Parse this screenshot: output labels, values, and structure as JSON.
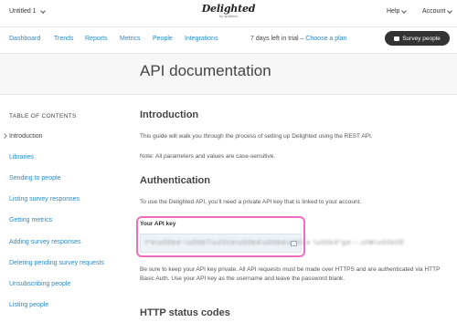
{
  "topbar": {
    "workspace": "Untitled 1",
    "logo_main": "Delighted",
    "logo_sub": "by qualtrics",
    "help": "Help",
    "account": "Account"
  },
  "nav": {
    "items": [
      "Dashboard",
      "Trends",
      "Reports",
      "Metrics",
      "People",
      "Integrations"
    ],
    "trial_text": "7 days left in trial –",
    "trial_link": "Choose a plan",
    "survey_button": "Survey people"
  },
  "page": {
    "title": "API documentation"
  },
  "toc": {
    "title": "TABLE OF CONTENTS",
    "items": [
      "Introduction",
      "Libraries",
      "Sending to people",
      "Listing survey responses",
      "Getting metrics",
      "Adding survey responses",
      "Deleting pending survey requests",
      "Unsubscribing people",
      "Listing people"
    ]
  },
  "content": {
    "intro_heading": "Introduction",
    "intro_p1": "This guide will walk you through the process of setting up Delighted using the REST API.",
    "intro_p2": "Note: All parameters and values are case-sensitive.",
    "auth_heading": "Authentication",
    "auth_p1": "To use the Delighted API, you'll need a private API key that is linked to your account.",
    "key_label": "Your API key",
    "key_value": "f*e\\u00b4~\\u00b7\\u201e\\u00b4\\u00bd\\u201e  \\u00b4*gd-~.ufM\\u00b0E",
    "auth_p2": "Be sure to keep your API key private. All API requests must be made over HTTPS and are authenticated via HTTP Basic Auth. Use your API key as the username and leave the password blank.",
    "status_heading": "HTTP status codes"
  }
}
